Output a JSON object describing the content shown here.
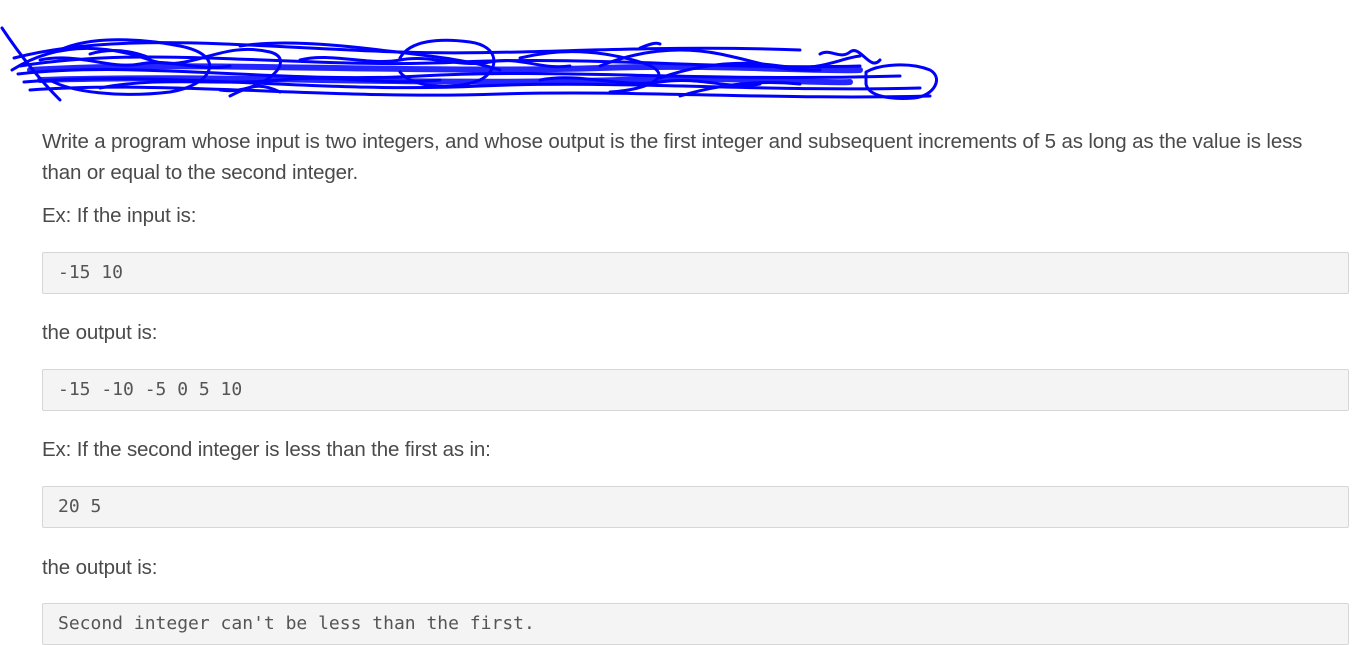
{
  "problem": {
    "title_redacted": true,
    "intro": "Write a program whose input is two integers, and whose output is the first integer and subsequent increments of 5 as long as the value is less than or equal to the second integer.",
    "example1_label": "Ex: If the input is:",
    "example1_input": "-15 10",
    "example1_output_label": "the output is:",
    "example1_output": "-15 -10 -5 0 5 10",
    "example2_label": "Ex: If the second integer is less than the first as in:",
    "example2_input": "20 5",
    "example2_output_label": "the output is:",
    "example2_output": "Second integer can't be less than the first."
  },
  "colors": {
    "scribble": "#0000ff",
    "code_background": "#f4f4f4",
    "code_border": "#d6d6d6",
    "text": "#4a4a4a"
  }
}
